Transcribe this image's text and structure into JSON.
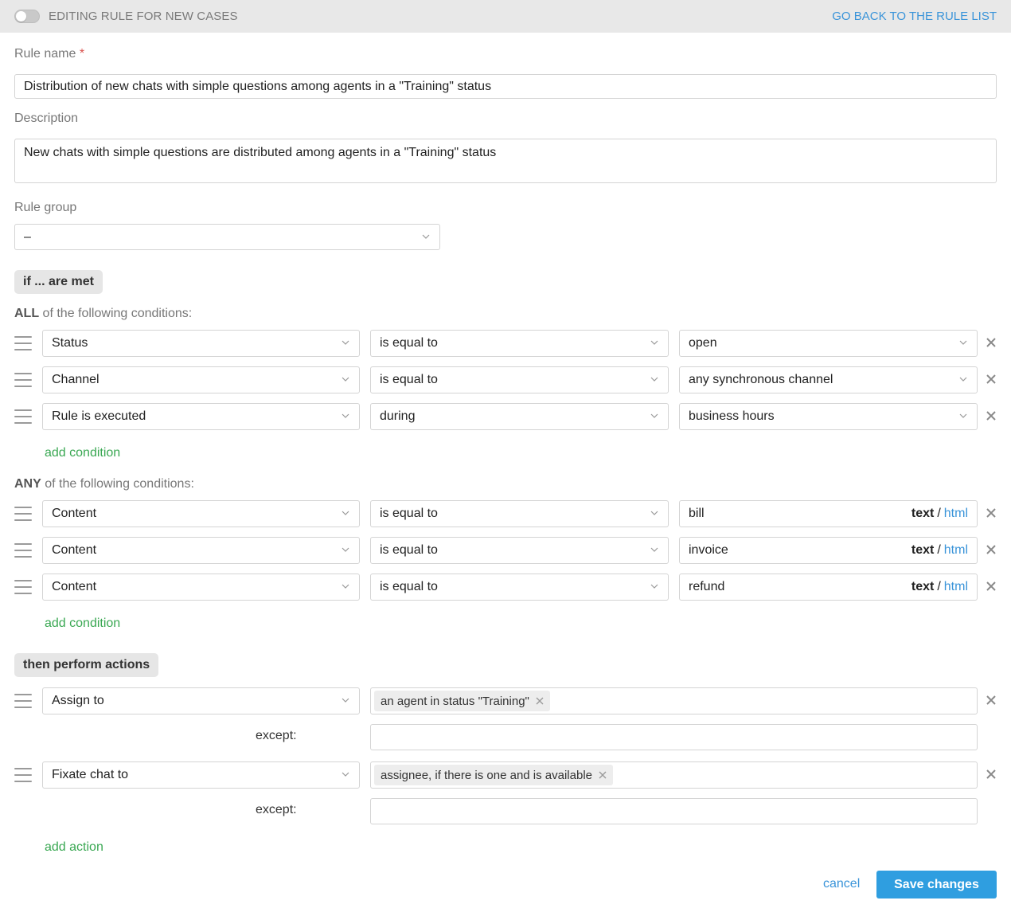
{
  "header": {
    "title": "EDITING RULE FOR NEW CASES",
    "back_link": "GO BACK TO THE RULE LIST",
    "toggle_enabled": false
  },
  "form": {
    "rule_name_label": "Rule name",
    "required_mark": "*",
    "rule_name_value": "Distribution of new chats with simple questions among agents in a \"Training\" status",
    "description_label": "Description",
    "description_value": "New chats with simple questions are distributed among agents in a \"Training\" status",
    "rule_group_label": "Rule group",
    "rule_group_value": "–"
  },
  "conditions": {
    "section_label": "if ... are met",
    "all": {
      "title_bold": "ALL",
      "title_rest": " of the following conditions:",
      "rows": [
        {
          "field": "Status",
          "operator": "is equal to",
          "value": "open"
        },
        {
          "field": "Channel",
          "operator": "is equal to",
          "value": "any synchronous channel"
        },
        {
          "field": "Rule is executed",
          "operator": "during",
          "value": "business hours"
        }
      ],
      "add_label": "add condition"
    },
    "any": {
      "title_bold": "ANY",
      "title_rest": " of the following conditions:",
      "rows": [
        {
          "field": "Content",
          "operator": "is equal to",
          "value": "bill",
          "mode_text": "text",
          "mode_sep": "/",
          "mode_html": "html"
        },
        {
          "field": "Content",
          "operator": "is equal to",
          "value": "invoice",
          "mode_text": "text",
          "mode_sep": "/",
          "mode_html": "html"
        },
        {
          "field": "Content",
          "operator": "is equal to",
          "value": "refund",
          "mode_text": "text",
          "mode_sep": "/",
          "mode_html": "html"
        }
      ],
      "add_label": "add condition"
    }
  },
  "actions": {
    "section_label": "then perform actions",
    "rows": [
      {
        "action": "Assign to",
        "tag": "an agent in status \"Training\"",
        "except_label": "except:",
        "except_value": ""
      },
      {
        "action": "Fixate chat to",
        "tag": "assignee, if there is one and is available",
        "except_label": "except:",
        "except_value": ""
      }
    ],
    "add_label": "add action"
  },
  "footer": {
    "cancel_label": "cancel",
    "save_label": "Save changes"
  },
  "icons": {
    "drag": "drag-handle-icon",
    "remove": "close-icon",
    "dropdown": "chevron-down-icon"
  },
  "colors": {
    "accent_blue": "#3a94d9",
    "button_blue": "#2f9ee0",
    "link_green": "#3aa853",
    "required_red": "#d9534f"
  }
}
